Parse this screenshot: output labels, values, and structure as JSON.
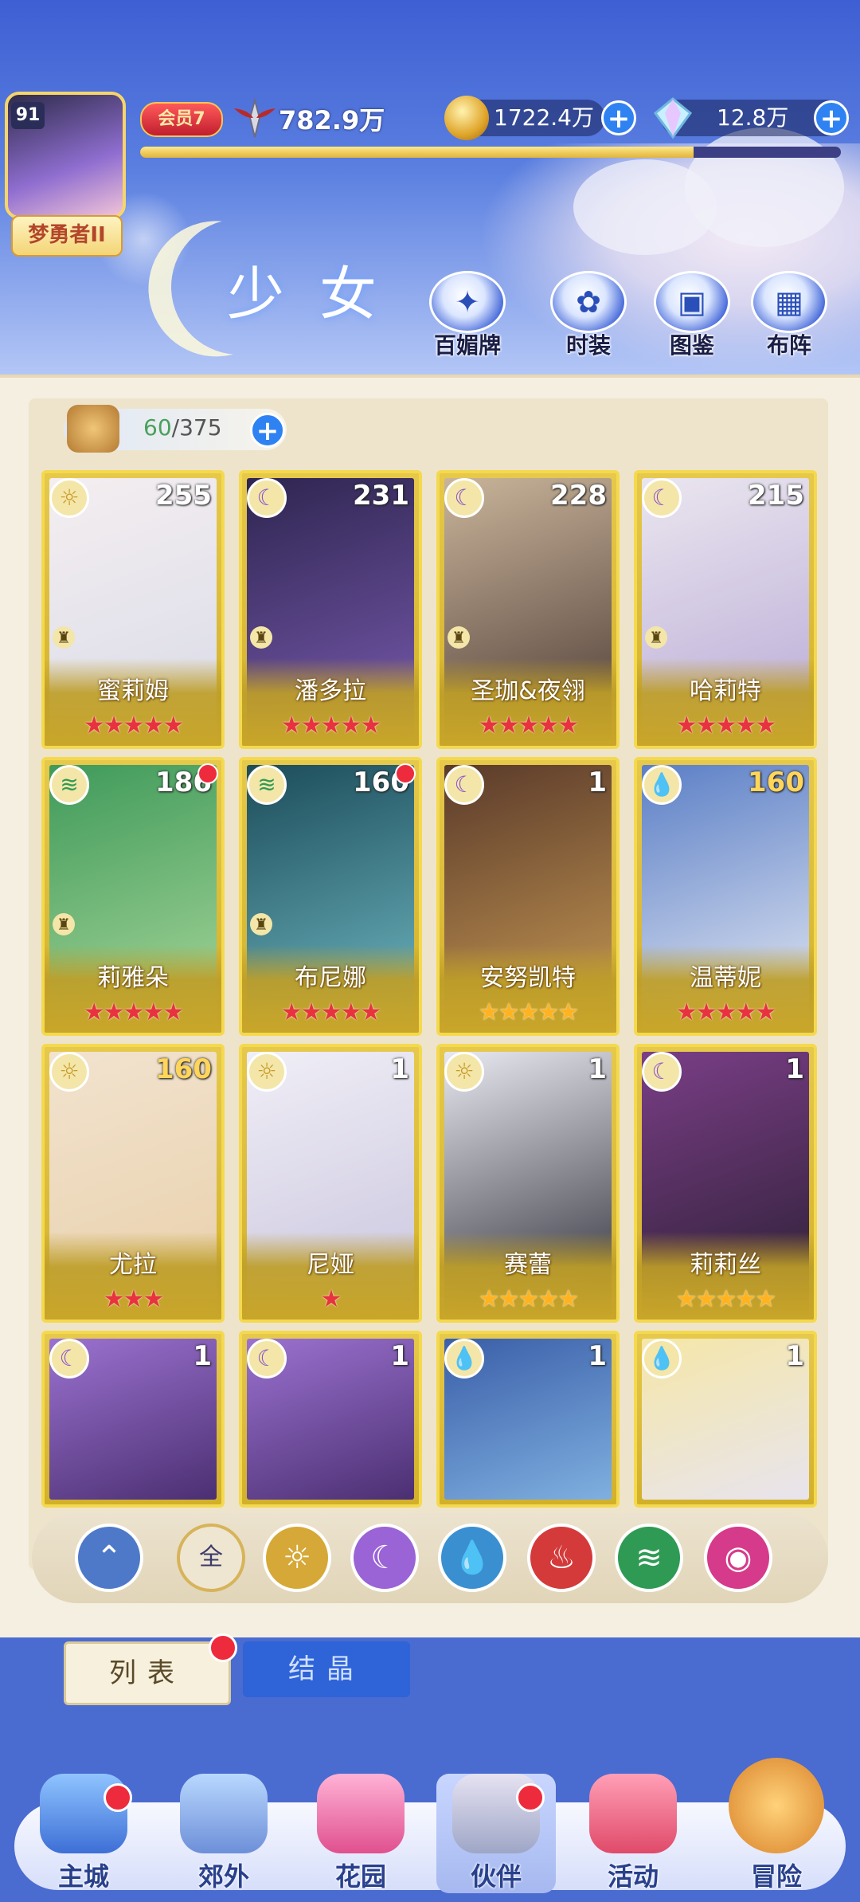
{
  "player": {
    "level": "91",
    "name": "梦勇者II",
    "vip": "会员7",
    "power": "782.9万",
    "exp_fraction": 0.79
  },
  "currency": {
    "gold": "1722.4万",
    "diamonds": "12.8万"
  },
  "section_title": "少女",
  "header_buttons": [
    {
      "label": "百媚牌",
      "icon": "badge-icon"
    },
    {
      "label": "时装",
      "icon": "outfit-icon"
    },
    {
      "label": "图鉴",
      "icon": "book-icon"
    },
    {
      "label": "布阵",
      "icon": "grid-icon"
    }
  ],
  "capacity": {
    "current": "60",
    "total": "/375"
  },
  "cards": [
    {
      "name": "蜜莉姆",
      "level": "255",
      "element": "light",
      "stars": "★★★★★",
      "star_color": "red",
      "rook": true,
      "dot": false,
      "level_gold": false,
      "art": [
        "#f4eef0",
        "#d9dbe8"
      ]
    },
    {
      "name": "潘多拉",
      "level": "231",
      "element": "moon",
      "stars": "★★★★★",
      "star_color": "red",
      "rook": true,
      "dot": false,
      "level_gold": false,
      "art": [
        "#2e2550",
        "#7a5bb0"
      ]
    },
    {
      "name": "圣珈&夜翎",
      "level": "228",
      "element": "moon",
      "stars": "★★★★★",
      "star_color": "red",
      "rook": true,
      "dot": false,
      "level_gold": false,
      "art": [
        "#c9b49a",
        "#4d3b35"
      ]
    },
    {
      "name": "哈莉特",
      "level": "215",
      "element": "moon",
      "stars": "★★★★★",
      "star_color": "red",
      "rook": true,
      "dot": false,
      "level_gold": false,
      "art": [
        "#eae6ef",
        "#b9aad6"
      ]
    },
    {
      "name": "莉雅朵",
      "level": "186",
      "element": "wind",
      "stars": "★★★★★",
      "star_color": "red",
      "rook": true,
      "dot": true,
      "level_gold": false,
      "art": [
        "#3f9a5a",
        "#a8d79a"
      ]
    },
    {
      "name": "布尼娜",
      "level": "160",
      "element": "wind",
      "stars": "★★★★★",
      "star_color": "red",
      "rook": true,
      "dot": true,
      "level_gold": false,
      "art": [
        "#1c4c5a",
        "#6fb8c2"
      ]
    },
    {
      "name": "安努凯特",
      "level": "1",
      "element": "moon",
      "stars": "★★★★★",
      "star_color": "gold",
      "rook": false,
      "dot": false,
      "level_gold": false,
      "art": [
        "#5a3a2a",
        "#c89a54"
      ]
    },
    {
      "name": "温蒂妮",
      "level": "160",
      "element": "water",
      "stars": "★★★★★",
      "star_color": "red",
      "rook": false,
      "dot": false,
      "level_gold": true,
      "art": [
        "#5b7fc6",
        "#e6eaf4"
      ]
    },
    {
      "name": "尤拉",
      "level": "160",
      "element": "light",
      "stars": "★★★",
      "star_color": "red",
      "rook": false,
      "dot": false,
      "level_gold": true,
      "art": [
        "#f2e3cf",
        "#e8cfa9"
      ]
    },
    {
      "name": "尼娅",
      "level": "1",
      "element": "light",
      "stars": "★",
      "star_color": "red",
      "rook": false,
      "dot": false,
      "level_gold": false,
      "art": [
        "#f0eef6",
        "#c9c4de"
      ]
    },
    {
      "name": "赛蕾",
      "level": "1",
      "element": "light",
      "stars": "★★★★★",
      "star_color": "gold",
      "rook": false,
      "dot": false,
      "level_gold": false,
      "art": [
        "#e8e8f0",
        "#2c2c36"
      ]
    },
    {
      "name": "莉莉丝",
      "level": "1",
      "element": "moon",
      "stars": "★★★★★",
      "star_color": "gold",
      "rook": false,
      "dot": false,
      "level_gold": false,
      "art": [
        "#7a3e86",
        "#2a1f33"
      ]
    },
    {
      "name": "",
      "level": "1",
      "element": "moon",
      "stars": "",
      "star_color": "red",
      "rook": false,
      "dot": false,
      "level_gold": false,
      "art": [
        "#9b72d0",
        "#4b2f72"
      ]
    },
    {
      "name": "",
      "level": "1",
      "element": "moon",
      "stars": "",
      "star_color": "red",
      "rook": false,
      "dot": false,
      "level_gold": false,
      "art": [
        "#9b72d0",
        "#4b2f72"
      ]
    },
    {
      "name": "",
      "level": "1",
      "element": "water",
      "stars": "",
      "star_color": "red",
      "rook": false,
      "dot": false,
      "level_gold": false,
      "art": [
        "#3a5ea8",
        "#7fb0e0"
      ]
    },
    {
      "name": "",
      "level": "1",
      "element": "water",
      "stars": "",
      "star_color": "red",
      "rook": false,
      "dot": false,
      "level_gold": false,
      "art": [
        "#f5e7a8",
        "#e8e4ee"
      ]
    }
  ],
  "filters": [
    {
      "icon": "collapse-icon",
      "label": "",
      "color": "#4e79c9"
    },
    {
      "icon": "all-icon",
      "label": "全",
      "color": "#efe6d2"
    },
    {
      "icon": "light-element-icon",
      "label": "",
      "color": "#d6a838"
    },
    {
      "icon": "moon-element-icon",
      "label": "",
      "color": "#9a63d6"
    },
    {
      "icon": "water-element-icon",
      "label": "",
      "color": "#3a8fd1"
    },
    {
      "icon": "fire-element-icon",
      "label": "",
      "color": "#d43a3a"
    },
    {
      "icon": "wind-element-icon",
      "label": "",
      "color": "#2f9a54"
    },
    {
      "icon": "heart-element-icon",
      "label": "",
      "color": "#d63a8a"
    }
  ],
  "tabs": {
    "list": "列表",
    "crystal": "结晶"
  },
  "nav": [
    {
      "label": "主城",
      "icon": "castle-icon",
      "dot": true
    },
    {
      "label": "郊外",
      "icon": "portal-icon",
      "dot": false
    },
    {
      "label": "花园",
      "icon": "heart-garden-icon",
      "dot": false
    },
    {
      "label": "伙伴",
      "icon": "partner-icon",
      "dot": true
    },
    {
      "label": "活动",
      "icon": "gift-icon",
      "dot": false
    },
    {
      "label": "冒险",
      "icon": "compass-icon",
      "dot": false
    }
  ],
  "colors": {
    "accent": "#2f82f2",
    "card_gold": "#e6c84b",
    "badge_red": "#ee2b3c"
  }
}
